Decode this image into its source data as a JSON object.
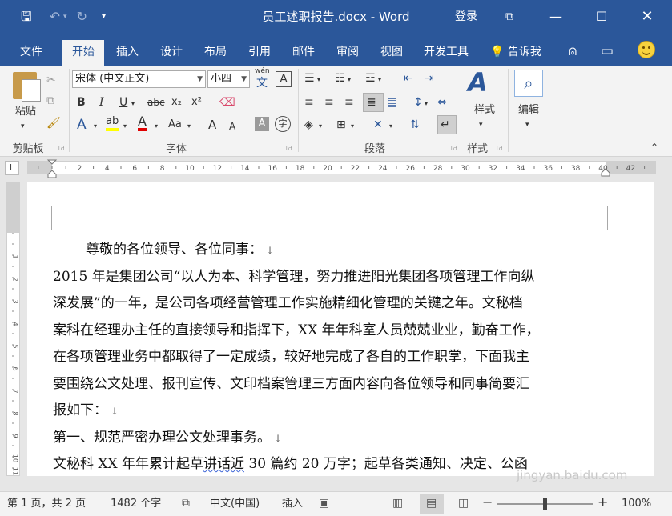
{
  "window": {
    "title": "员工述职报告.docx - Word",
    "login": "登录"
  },
  "tabs": [
    "文件",
    "开始",
    "插入",
    "设计",
    "布局",
    "引用",
    "邮件",
    "审阅",
    "视图",
    "开发工具"
  ],
  "active_tab": "开始",
  "tell_me": "告诉我",
  "ribbon": {
    "clipboard": {
      "paste_label": "粘贴",
      "group_label": "剪贴板"
    },
    "font": {
      "font_name": "宋体 (中文正文)",
      "font_size": "小四",
      "pinyin_label": "wén",
      "group_label": "字体",
      "bold": "B",
      "italic": "I",
      "underline": "U",
      "strike": "abc",
      "subscript": "x₂",
      "superscript": "x²",
      "font_color": "A",
      "highlight": "ab",
      "case": "Aa",
      "grow": "A",
      "shrink": "A",
      "char_shading": "A",
      "enclose": "字"
    },
    "paragraph": {
      "group_label": "段落"
    },
    "styles": {
      "label": "样式",
      "group_label": "样式"
    },
    "editing": {
      "label": "编辑"
    }
  },
  "ruler": {
    "labels": [
      "2",
      "2",
      "4",
      "6",
      "8",
      "10",
      "12",
      "14",
      "16",
      "18",
      "20",
      "22",
      "24",
      "26",
      "28",
      "30",
      "32",
      "34",
      "36",
      "38",
      "40",
      "42"
    ]
  },
  "vruler": {
    "labels": [
      "2",
      "1",
      "1",
      "2",
      "3",
      "4",
      "5",
      "6",
      "7",
      "8",
      "9",
      "10",
      "11"
    ]
  },
  "document": {
    "paragraphs": [
      "尊敬的各位领导、各位同事：",
      "2015 年是集团公司“以人为本、科学管理，努力推进阳光集团各项管理工作向纵",
      "深发展”的一年，是公司各项经营管理工作实施精细化管理的关键之年。文秘档",
      "案科在经理办主任的直接领导和指挥下，XX 年年科室人员兢兢业业，勤奋工作，",
      "在各项管理业务中都取得了一定成绩，较好地完成了各自的工作职掌，下面我主",
      "要围绕公文处理、报刊宣传、文印档案管理三方面内容向各位领导和同事简要汇",
      "报如下：",
      "第一、规范严密办理公文处理事务。",
      "文秘科 XX 年年累计起草讲话近 30 篇约 20 万字；起草各类通知、决定、公函"
    ],
    "para_mark": "↓",
    "wavy_word": "讲话近"
  },
  "status": {
    "page": "第 1 页，共 2 页",
    "words": "1482 个字",
    "language": "中文(中国)",
    "mode": "插入",
    "zoom": "100%"
  },
  "watermark": "jingyan.baidu.com",
  "colors": {
    "accent": "#2b579a",
    "ribbon_bg": "#f3f3f3",
    "doc_bg": "#e6e6e6"
  }
}
